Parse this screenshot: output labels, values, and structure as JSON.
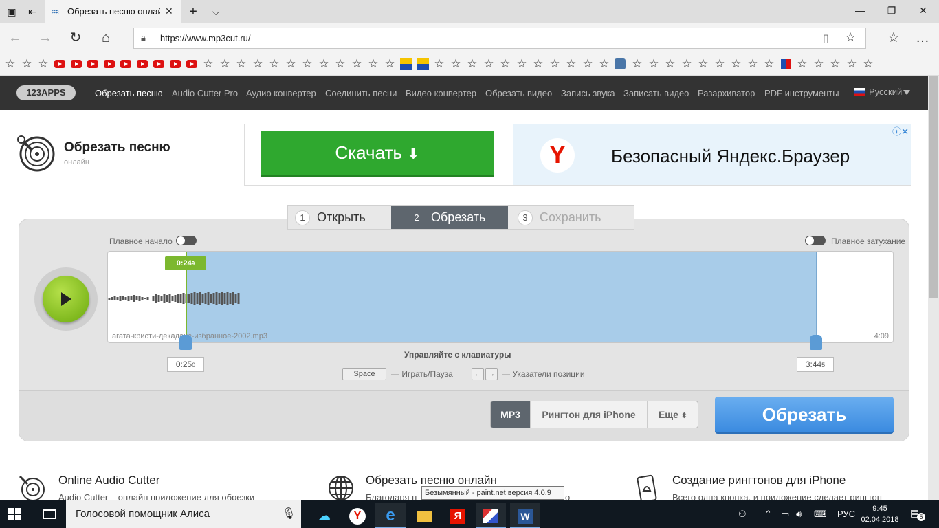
{
  "browser": {
    "tab_title": "Обрезать песню онлай",
    "url": "https://www.mp3cut.ru/",
    "new_tab": "+",
    "tab_menu": "⌵"
  },
  "site_nav": {
    "logo": "123APPS",
    "items": [
      "Обрезать песню",
      "Audio Cutter Pro",
      "Аудио конвертер",
      "Соединить песни",
      "Видео конвертер",
      "Обрезать видео",
      "Запись звука",
      "Записать видео",
      "Разархиватор",
      "PDF инструменты"
    ],
    "language": "Русский"
  },
  "header": {
    "title": "Обрезать песню",
    "subtitle": "онлайн"
  },
  "ad": {
    "download_label": "Скачать",
    "text": "Безопасный Яндекс.Браузер",
    "logo_letter": "Y"
  },
  "steps": [
    {
      "num": "1",
      "label": "Открыть"
    },
    {
      "num": "2",
      "label": "Обрезать"
    },
    {
      "num": "3",
      "label": "Сохранить"
    }
  ],
  "editor": {
    "fade_in_label": "Плавное начало",
    "fade_out_label": "Плавное затухание",
    "filename": "агата-кристи-декаданс-избранное-2002.mp3",
    "duration": "4:09",
    "cursor_time": "0:24",
    "cursor_time_frac": "9",
    "start_time": "0:25",
    "start_time_frac": "0",
    "end_time": "3:44",
    "end_time_frac": "5",
    "keyboard_hint": "Управляйте с клавиатуры",
    "space_key": "Space",
    "space_desc": "— Играть/Пауза",
    "arrow_left": "←",
    "arrow_right": "→",
    "arrows_desc": "— Указатели позиции",
    "formats": {
      "mp3": "MP3",
      "iphone": "Рингтон для iPhone",
      "more": "Еще"
    },
    "cut_button": "Обрезать"
  },
  "features": [
    {
      "title": "Online Audio Cutter",
      "text": "Audio Cutter – онлайн приложение для обрезки"
    },
    {
      "title": "Обрезать песню онлайн",
      "text": "Благодаря н"
    },
    {
      "title": "Создание рингтонов для iPhone",
      "text": "Всего одна кнопка, и приложение сделает рингтон"
    }
  ],
  "tooltip": "Безымянный - paint.net версия 4.0.9",
  "tooltip_tail": "о",
  "taskbar": {
    "search_text": "Голосовой помощник Алиса",
    "lang": "РУС",
    "time": "9:45",
    "date": "02.04.2018",
    "notifications": "5"
  },
  "colors": {
    "accent_green": "#7cb82f",
    "selection_blue": "#a8cce9",
    "cut_button": "#3b8be0",
    "nav_bg": "#333333"
  }
}
